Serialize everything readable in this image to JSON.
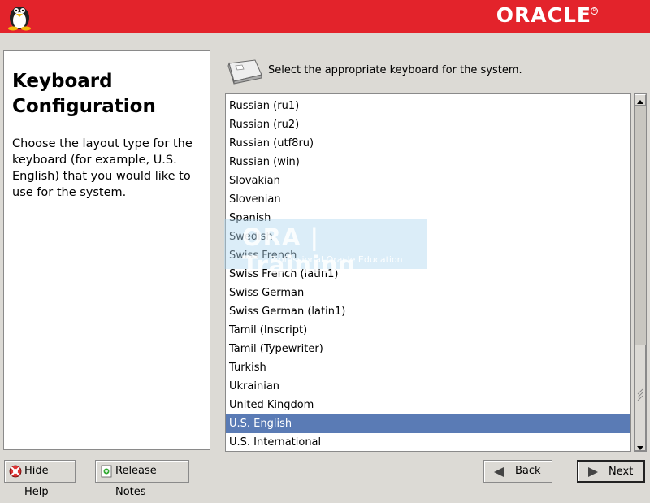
{
  "header": {
    "brand": "ORACLE",
    "brand_color": "#e3232b"
  },
  "help_panel": {
    "title": "Keyboard Configuration",
    "body": "Choose the layout type for the keyboard (for example, U.S. English) that you would like to use for the system."
  },
  "main": {
    "prompt": "Select the appropriate keyboard for the system.",
    "icon": "keyboard-icon",
    "layouts": [
      "Russian (ru1)",
      "Russian (ru2)",
      "Russian (utf8ru)",
      "Russian (win)",
      "Slovakian",
      "Slovenian",
      "Spanish",
      "Swedish",
      "Swiss French",
      "Swiss French (latin1)",
      "Swiss German",
      "Swiss German (latin1)",
      "Tamil (Inscript)",
      "Tamil (Typewriter)",
      "Turkish",
      "Ukrainian",
      "United Kingdom",
      "U.S. English",
      "U.S. International"
    ],
    "selected": "U.S. English",
    "selection_color": "#5a7bb5"
  },
  "watermark": {
    "big": "ORA | Training",
    "small": "Professional Oracle Education"
  },
  "footer": {
    "hide_help": "Hide Help",
    "release_notes": "Release Notes",
    "back": "Back",
    "next": "Next"
  }
}
